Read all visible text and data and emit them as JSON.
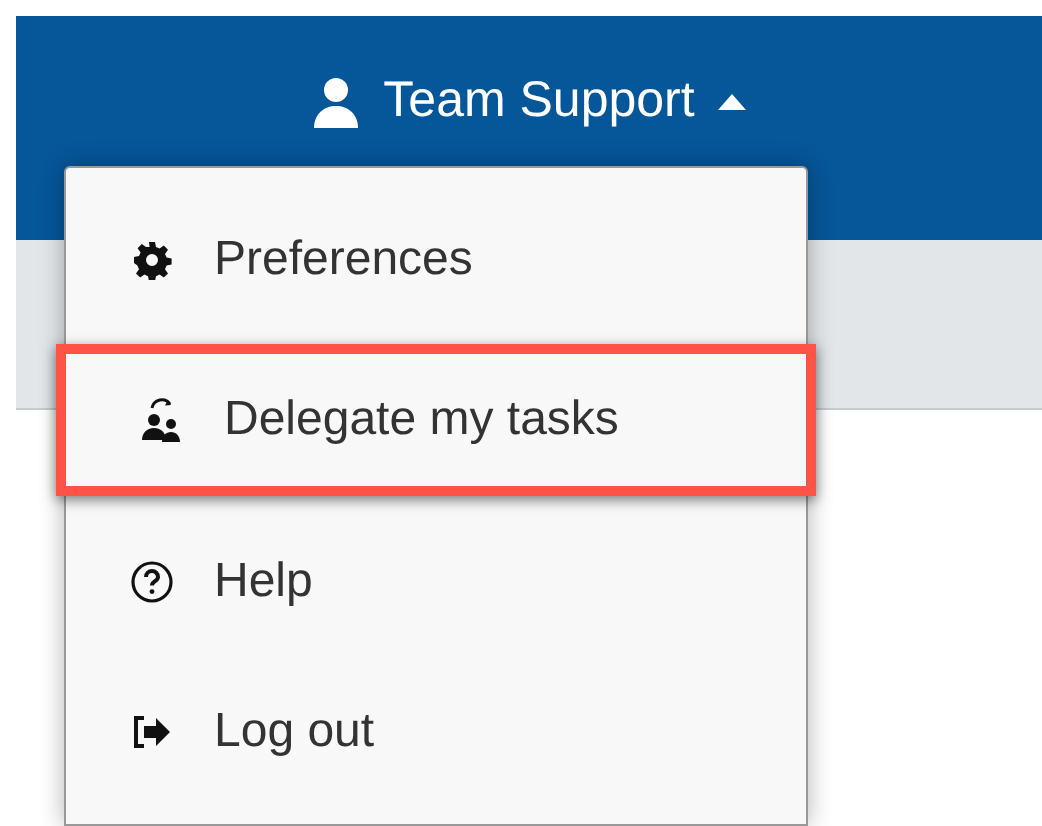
{
  "header": {
    "user": "Team Support",
    "menu_expanded": true
  },
  "menu": [
    {
      "kind": "preferences",
      "label": "Preferences",
      "highlighted": false
    },
    {
      "kind": "delegate",
      "label": "Delegate my tasks",
      "highlighted": true
    },
    {
      "kind": "help",
      "label": "Help",
      "highlighted": false
    },
    {
      "kind": "logout",
      "label": "Log out",
      "highlighted": false
    }
  ]
}
